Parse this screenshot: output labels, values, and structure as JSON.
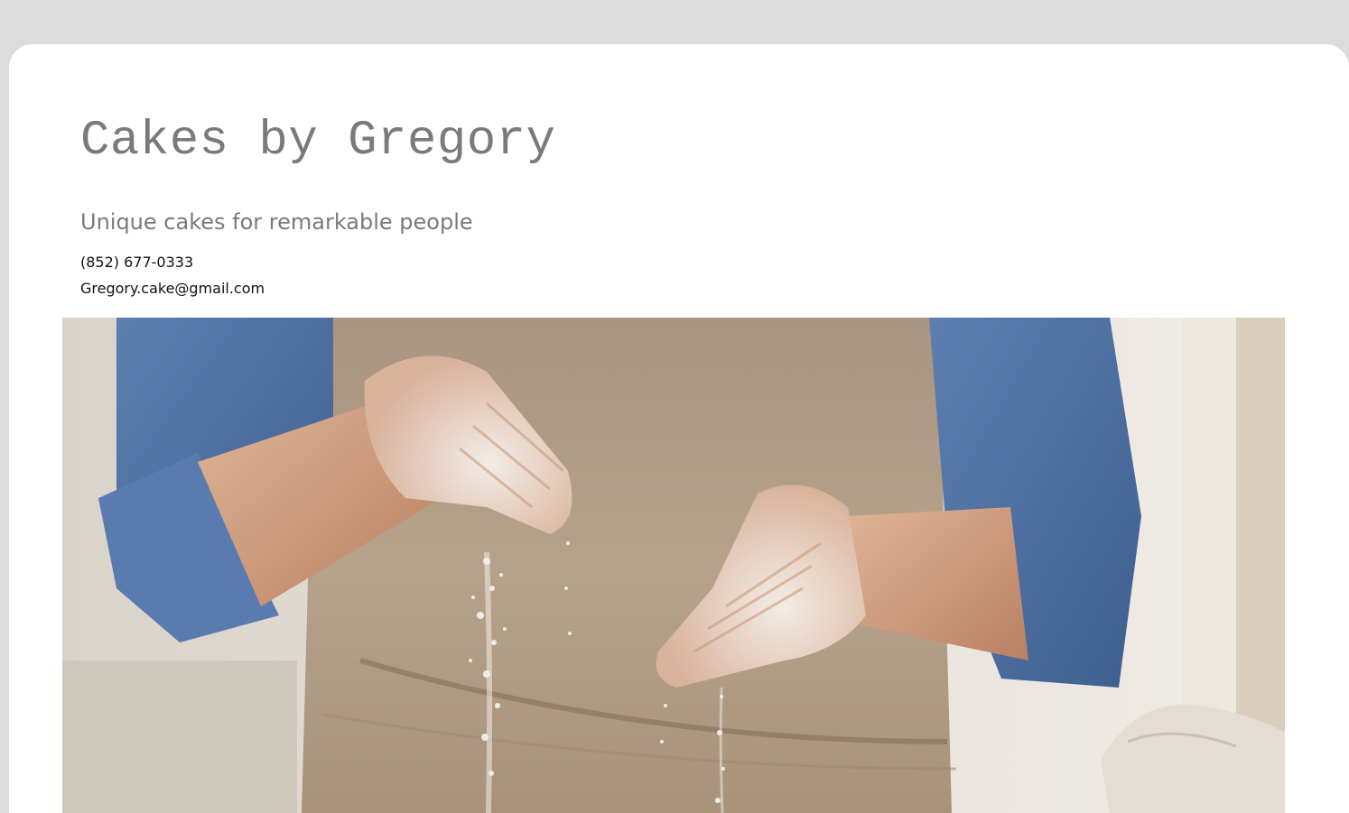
{
  "site": {
    "title": "Cakes by Gregory",
    "tagline": "Unique cakes for remarkable people",
    "phone": "(852) 677-0333",
    "email": "Gregory.cake@gmail.com"
  },
  "hero_image": {
    "subject": "baker-hands-sprinkling-flour",
    "alt": ""
  },
  "colors": {
    "page_background": "#dcdcdc",
    "card_background": "#ffffff",
    "title_gray": "#7a7a7a",
    "apron": "#b29c84",
    "shirt_blue": "#4f6f9f"
  }
}
